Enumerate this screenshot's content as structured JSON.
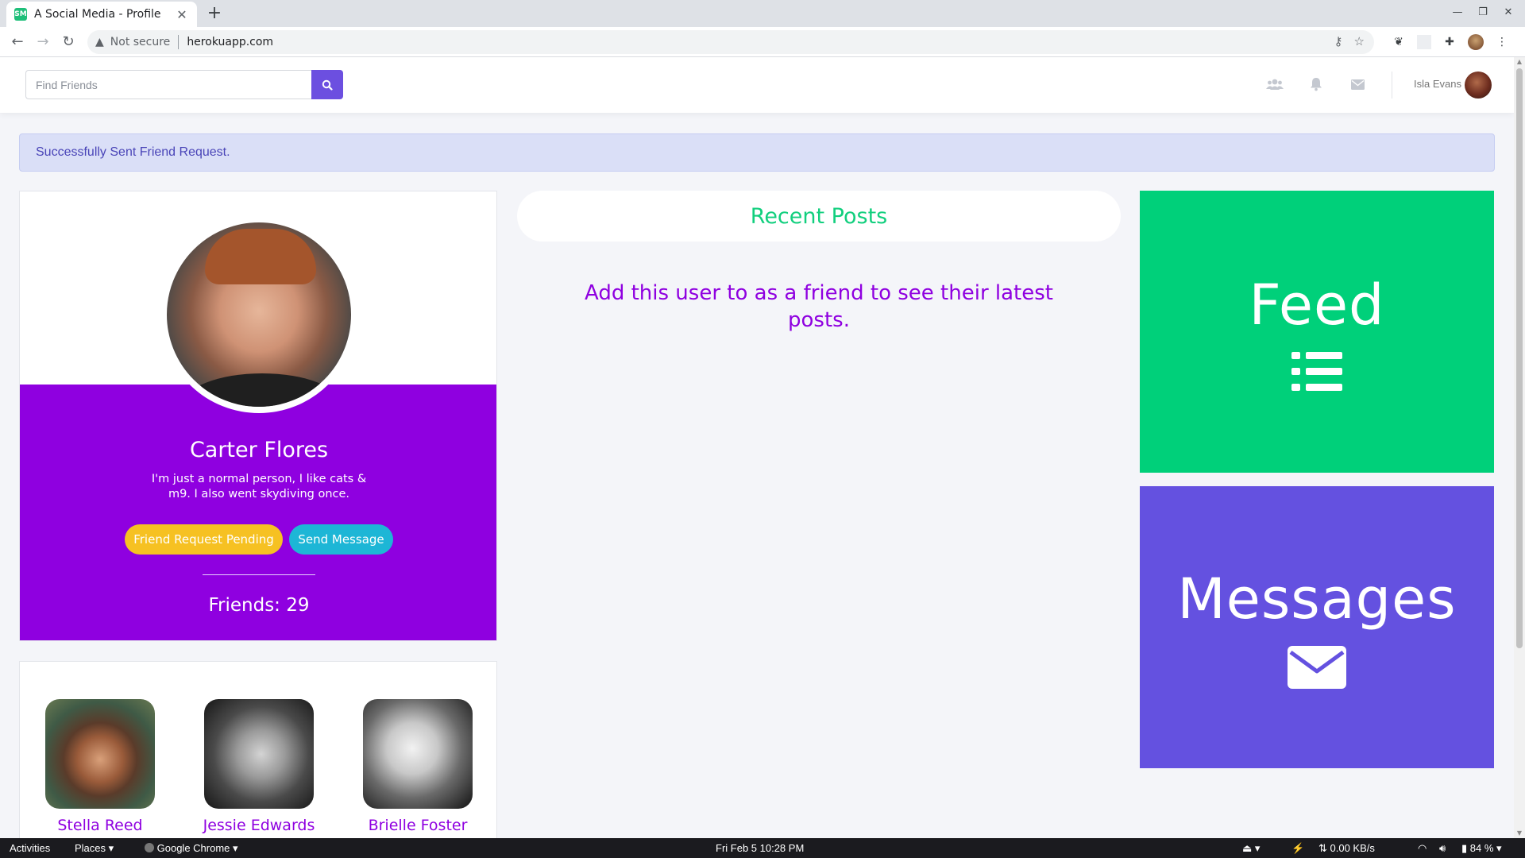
{
  "browser": {
    "tab_title": "A Social Media - Profile",
    "favicon_text": "SM",
    "security_label": "Not secure",
    "url": "herokuapp.com"
  },
  "navbar": {
    "search_placeholder": "Find Friends",
    "user_name": "Isla Evans",
    "icons": [
      "users-icon",
      "bell-icon",
      "envelope-icon"
    ]
  },
  "alert": {
    "message": "Successfully Sent Friend Request."
  },
  "profile": {
    "name": "Carter Flores",
    "bio": "I'm just a normal person, I like cats & m9. I also went skydiving once.",
    "pending_button": "Friend Request Pending",
    "message_button": "Send Message",
    "friends_label": "Friends: 29"
  },
  "friends": [
    {
      "name": "Stella Reed"
    },
    {
      "name": "Jessie Edwards"
    },
    {
      "name": "Brielle Foster"
    }
  ],
  "posts": {
    "header": "Recent Posts",
    "empty_message": "Add this user to as a friend to see their latest posts."
  },
  "tiles": {
    "feed": "Feed",
    "messages": "Messages"
  },
  "taskbar": {
    "activities": "Activities",
    "places": "Places",
    "app": "Google Chrome",
    "datetime": "Fri Feb 5  10:28 PM",
    "network": "0.00 KB/s",
    "battery": "84 %"
  },
  "colors": {
    "purple": "#8f00e0",
    "green": "#00d07a",
    "indigo": "#6451e0",
    "yellow": "#f6c122",
    "cyan": "#1db6d6"
  }
}
